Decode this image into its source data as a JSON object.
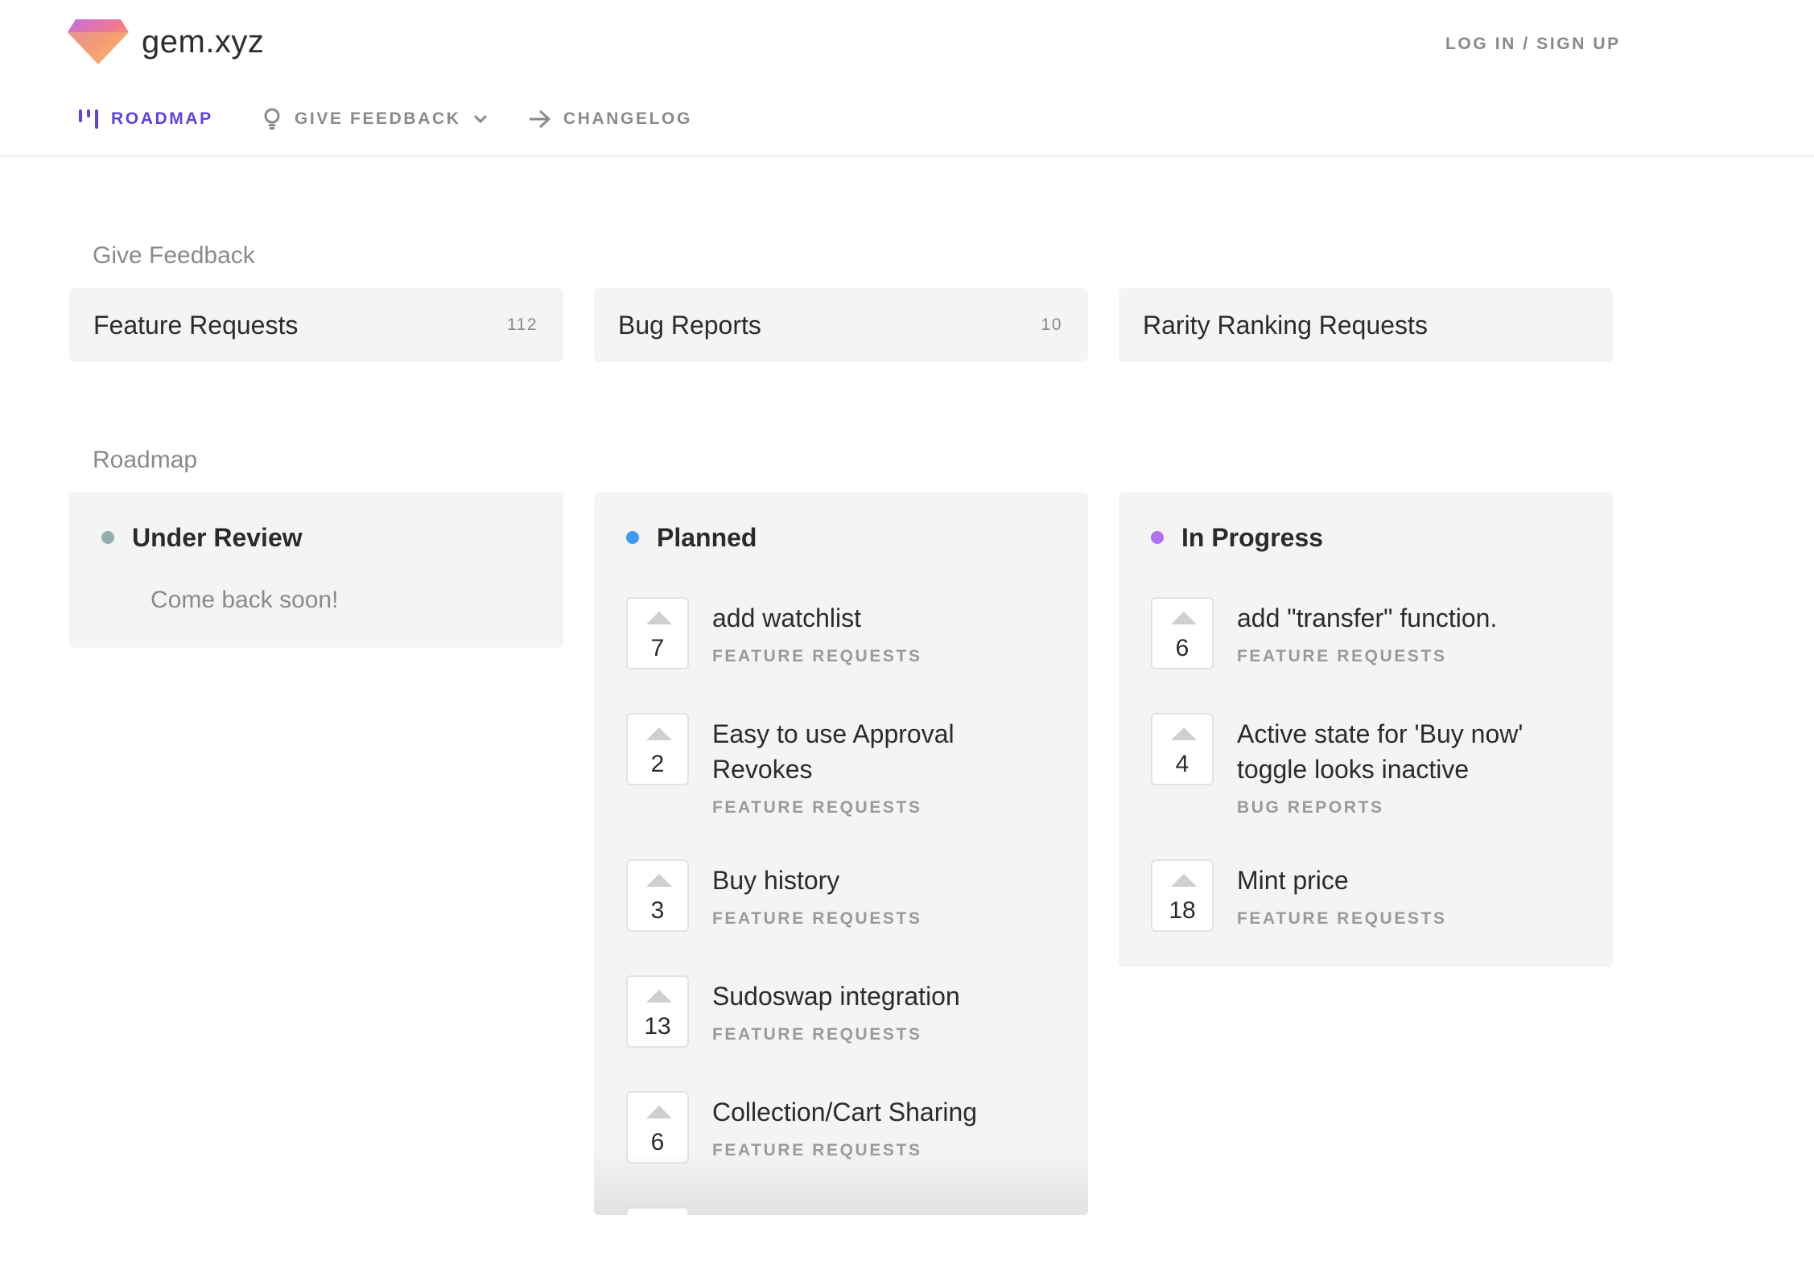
{
  "header": {
    "brand": "gem.xyz",
    "login": "LOG IN / SIGN UP",
    "nav": [
      {
        "label": "ROADMAP",
        "icon": "roadmap-icon",
        "active": true
      },
      {
        "label": "GIVE FEEDBACK",
        "icon": "lightbulb-icon",
        "dropdown": true
      },
      {
        "label": "CHANGELOG",
        "icon": "arrow-right-icon"
      }
    ]
  },
  "colors": {
    "accent": "#5b45e0",
    "under_review": "#8fb0ad",
    "planned": "#3d9bf0",
    "in_progress": "#b071f0"
  },
  "feedback": {
    "title": "Give Feedback",
    "boards": [
      {
        "name": "Feature Requests",
        "count": "112"
      },
      {
        "name": "Bug Reports",
        "count": "10"
      },
      {
        "name": "Rarity Ranking Requests",
        "count": ""
      }
    ]
  },
  "roadmap": {
    "title": "Roadmap",
    "columns": [
      {
        "title": "Under Review",
        "empty": "Come back soon!",
        "posts": []
      },
      {
        "title": "Planned",
        "posts": [
          {
            "votes": "7",
            "title": "add watchlist",
            "tag": "FEATURE REQUESTS"
          },
          {
            "votes": "2",
            "title": "Easy to use Approval Revokes",
            "tag": "FEATURE REQUESTS"
          },
          {
            "votes": "3",
            "title": "Buy history",
            "tag": "FEATURE REQUESTS"
          },
          {
            "votes": "13",
            "title": "Sudoswap integration",
            "tag": "FEATURE REQUESTS"
          },
          {
            "votes": "6",
            "title": "Collection/Cart Sharing",
            "tag": "FEATURE REQUESTS"
          }
        ]
      },
      {
        "title": "In Progress",
        "posts": [
          {
            "votes": "6",
            "title": "add \"transfer\" function.",
            "tag": "FEATURE REQUESTS"
          },
          {
            "votes": "4",
            "title": "Active state for 'Buy now' toggle looks inactive",
            "tag": "BUG REPORTS"
          },
          {
            "votes": "18",
            "title": "Mint price",
            "tag": "FEATURE REQUESTS"
          }
        ]
      }
    ]
  }
}
